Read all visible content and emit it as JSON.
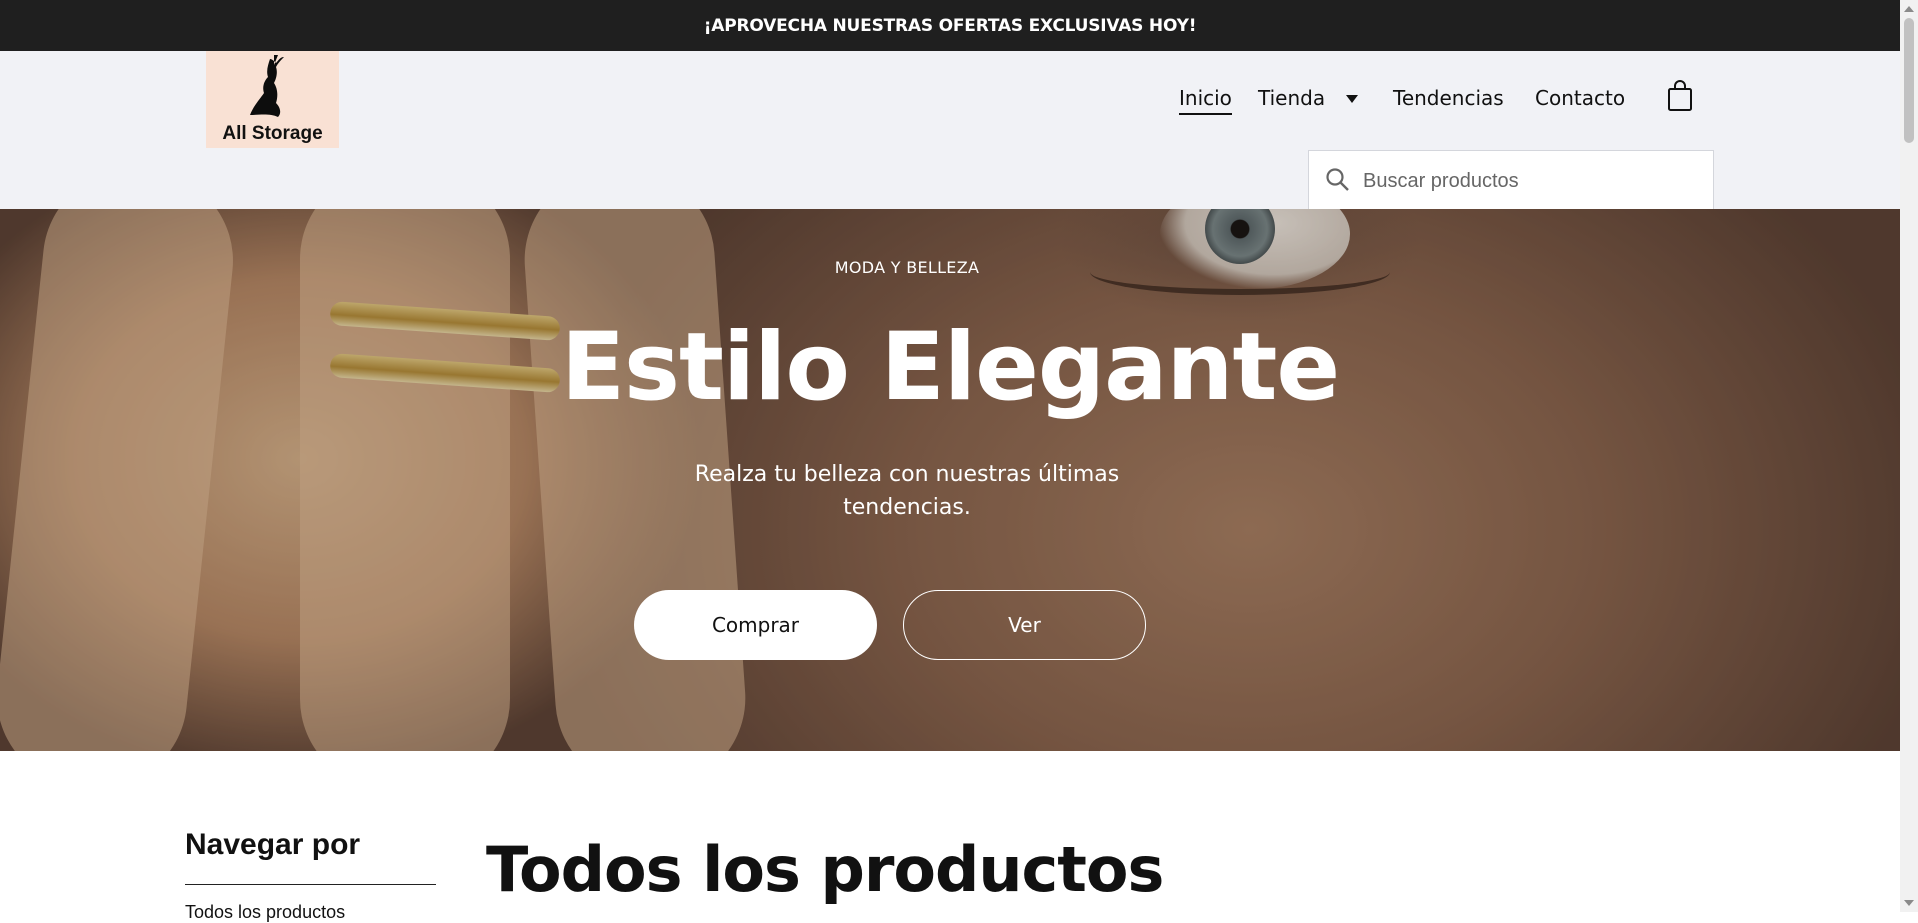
{
  "announcement": {
    "text": "¡APROVECHA NUESTRAS OFERTAS EXCLUSIVAS HOY!"
  },
  "brand": {
    "logo_text": "All Storage"
  },
  "nav": {
    "items": [
      {
        "label": "Inicio",
        "active": true
      },
      {
        "label": "Tienda",
        "has_dropdown": true
      },
      {
        "label": "Tendencias"
      },
      {
        "label": "Contacto"
      }
    ],
    "cart_icon": "shopping-bag-icon"
  },
  "search": {
    "placeholder": "Buscar productos",
    "value": "",
    "icon": "search-icon"
  },
  "hero": {
    "eyebrow": "MODA Y BELLEZA",
    "title": "Estilo Elegante",
    "subtitle": "Realza tu belleza con nuestras últimas tendencias.",
    "buttons": [
      {
        "label": "Comprar"
      },
      {
        "label": "Ver"
      }
    ]
  },
  "sidebar": {
    "title": "Navegar por",
    "items": [
      {
        "label": "Todos los productos"
      }
    ]
  },
  "main": {
    "title": "Todos los productos"
  },
  "colors": {
    "announcement_bg": "#1f1f1f",
    "header_bg": "#f1f2f6",
    "logo_bg": "#f9e1d4",
    "text": "#111111",
    "hero_text": "#ffffff"
  }
}
